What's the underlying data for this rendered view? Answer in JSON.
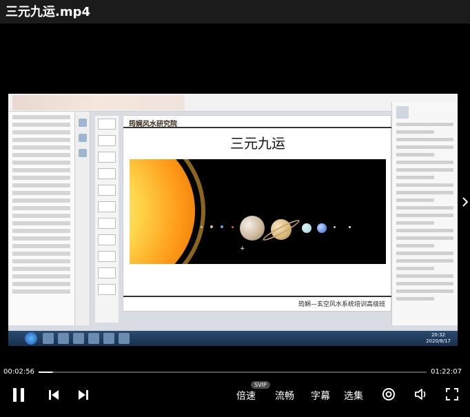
{
  "window": {
    "title": "三元九运.mp4"
  },
  "video": {
    "slide_title": "三元九运",
    "slide_brand": "筠娴风水研究院",
    "slide_footer": "筠娴—玄空风水系统培训高级班"
  },
  "player": {
    "current_time": "00:02:56",
    "total_time": "01:22:07",
    "progress_fraction": 0.036,
    "buffered_fraction": 0.039,
    "speed_label": "倍速",
    "speed_badge": "SVIP",
    "quality_label": "流畅",
    "subtitle_label": "字幕",
    "episodes_label": "选集"
  },
  "icons": {
    "pause": "pause-icon",
    "prev": "skip-previous-icon",
    "next": "skip-next-icon",
    "snapshot": "circle-target-icon",
    "volume": "volume-icon",
    "fullscreen": "fullscreen-icon",
    "side": "chevron-right-icon"
  }
}
